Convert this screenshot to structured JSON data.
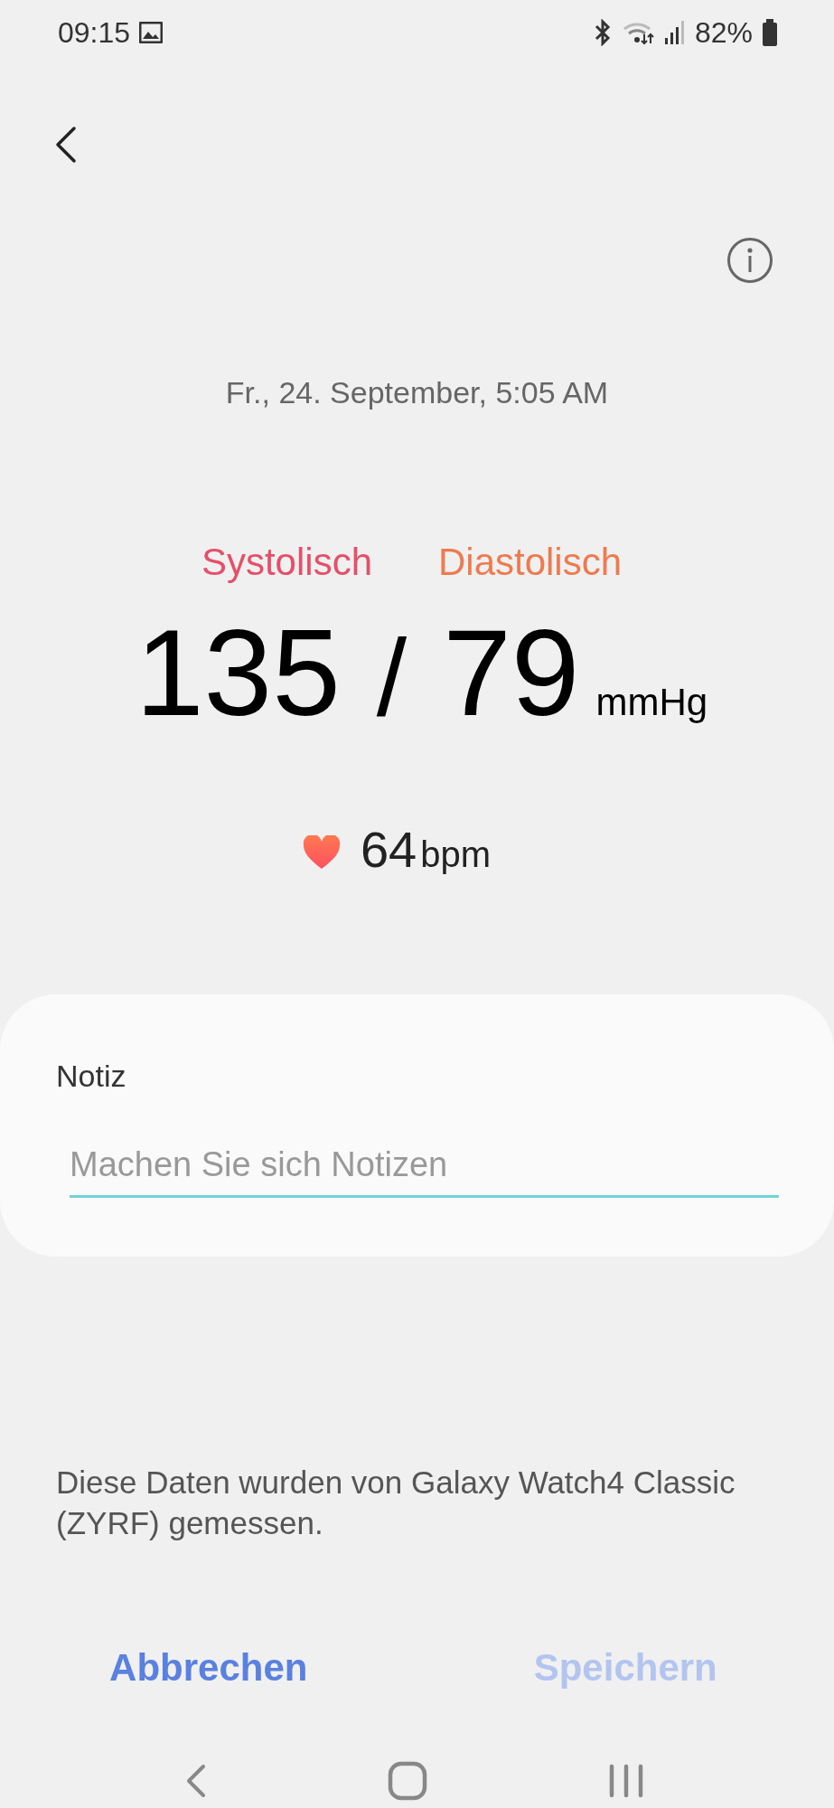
{
  "status_bar": {
    "time": "09:15",
    "battery": "82%"
  },
  "date": "Fr., 24. September, 5:05 AM",
  "reading": {
    "systolic_label": "Systolisch",
    "diastolic_label": "Diastolisch",
    "systolic": "135",
    "separator": "/",
    "diastolic": "79",
    "unit": "mmHg",
    "pulse": "64",
    "pulse_unit": "bpm"
  },
  "note": {
    "label": "Notiz",
    "placeholder": "Machen Sie sich Notizen"
  },
  "source_text": "Diese Daten wurden von Galaxy Watch4 Classic (ZYRF) gemessen.",
  "buttons": [
    {
      "label": "Abbrechen",
      "disabled": false
    },
    {
      "label": "Speichern",
      "disabled": true
    }
  ]
}
